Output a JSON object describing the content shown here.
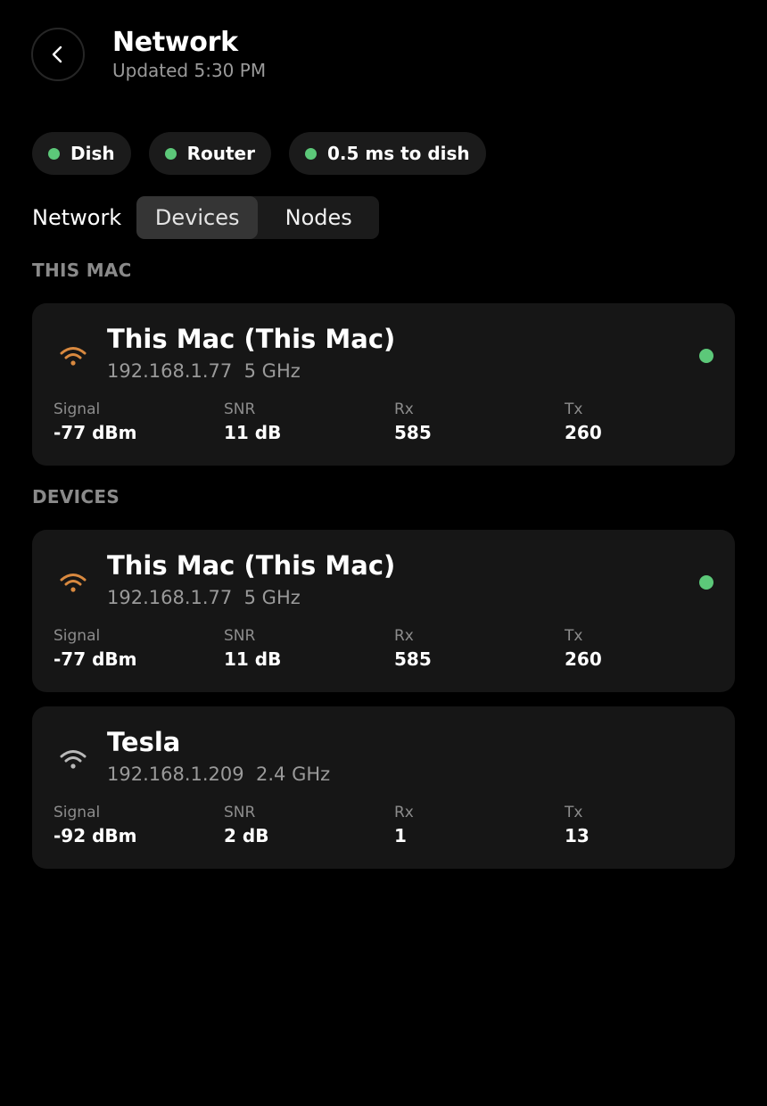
{
  "header": {
    "title": "Network",
    "updated": "Updated 5:30 PM"
  },
  "status_pills": [
    {
      "label": "Dish"
    },
    {
      "label": "Router"
    },
    {
      "label": "0.5 ms to dish"
    }
  ],
  "tabs": {
    "label": "Network",
    "items": [
      {
        "label": "Devices",
        "selected": true
      },
      {
        "label": "Nodes",
        "selected": false
      }
    ]
  },
  "sections": {
    "this_mac": "THIS MAC",
    "devices": "DEVICES"
  },
  "stat_labels": {
    "signal": "Signal",
    "snr": "SNR",
    "rx": "Rx",
    "tx": "Tx"
  },
  "this_mac_card": {
    "name": "This Mac (This Mac)",
    "ip": "192.168.1.77",
    "band": "5 GHz",
    "signal": "-77 dBm",
    "snr": "11 dB",
    "rx": "585",
    "tx": "260",
    "wifi_color": "#d9893f",
    "online": true
  },
  "device_cards": [
    {
      "name": "This Mac (This Mac)",
      "ip": "192.168.1.77",
      "band": "5 GHz",
      "signal": "-77 dBm",
      "snr": "11 dB",
      "rx": "585",
      "tx": "260",
      "wifi_color": "#d9893f",
      "online": true
    },
    {
      "name": "Tesla",
      "ip": "192.168.1.209",
      "band": "2.4 GHz",
      "signal": "-92 dBm",
      "snr": "2 dB",
      "rx": "1",
      "tx": "13",
      "wifi_color": "#b9b9b9",
      "online": false
    }
  ],
  "colors": {
    "online_dot": "#5cc879",
    "wifi_orange": "#d9893f",
    "wifi_grey": "#b9b9b9"
  },
  "icons": {
    "back": "chevron-left-icon",
    "wifi": "wifi-icon"
  }
}
